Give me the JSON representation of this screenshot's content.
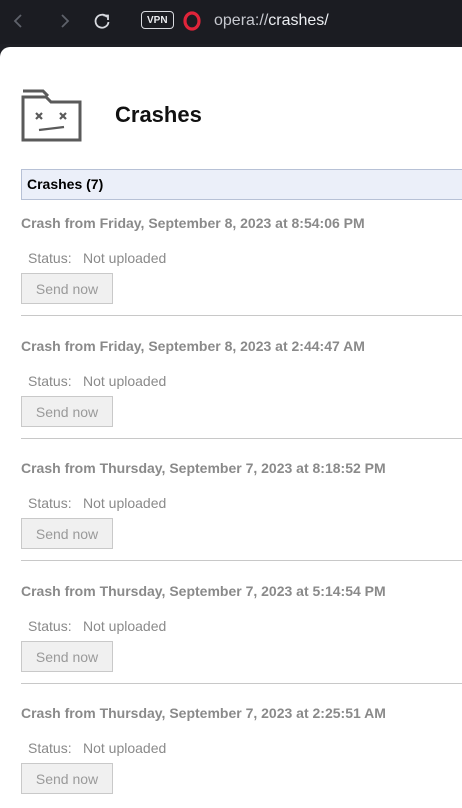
{
  "browser": {
    "vpn_label": "VPN",
    "url_scheme": "opera://",
    "url_host": "crashes/"
  },
  "page": {
    "title": "Crashes",
    "section_header": "Crashes (7)"
  },
  "crashes": [
    {
      "title": "Crash from Friday, September 8, 2023 at 8:54:06 PM",
      "status_label": "Status:",
      "status_value": "Not uploaded",
      "button_label": "Send now"
    },
    {
      "title": "Crash from Friday, September 8, 2023 at 2:44:47 AM",
      "status_label": "Status:",
      "status_value": "Not uploaded",
      "button_label": "Send now"
    },
    {
      "title": "Crash from Thursday, September 7, 2023 at 8:18:52 PM",
      "status_label": "Status:",
      "status_value": "Not uploaded",
      "button_label": "Send now"
    },
    {
      "title": "Crash from Thursday, September 7, 2023 at 5:14:54 PM",
      "status_label": "Status:",
      "status_value": "Not uploaded",
      "button_label": "Send now"
    },
    {
      "title": "Crash from Thursday, September 7, 2023 at 2:25:51 AM",
      "status_label": "Status:",
      "status_value": "Not uploaded",
      "button_label": "Send now"
    }
  ],
  "colors": {
    "toolbar_bg": "#1b1c22",
    "opera_red": "#e0243a",
    "section_bg": "#ebeff9"
  }
}
